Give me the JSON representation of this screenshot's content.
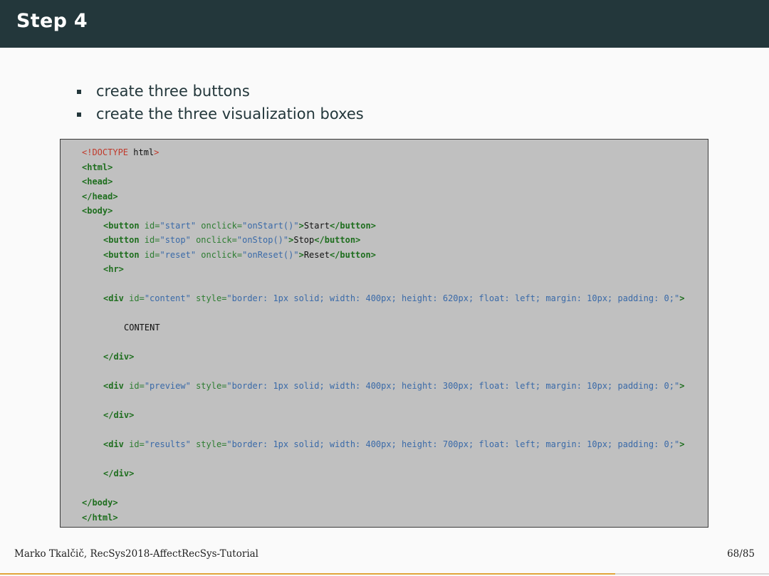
{
  "slide": {
    "title": "Step 4",
    "bullets": [
      "create three buttons",
      "create the three visualization boxes"
    ]
  },
  "code": {
    "doctype_open": "<!DOCTYPE",
    "doctype_html": " html",
    "doctype_close": ">",
    "html_open": "<html>",
    "head_open": "<head>",
    "head_close": "</head>",
    "body_open": "<body>",
    "button_tag": "<button",
    "button_close": "</button>",
    "id_attr": " id=",
    "onclick_attr": " onclick=",
    "style_attr": " style=",
    "gt": ">",
    "start_id": "\"start\"",
    "start_onclick": "\"onStart()\"",
    "start_text": "Start",
    "stop_id": "\"stop\"",
    "stop_onclick": "\"onStop()\"",
    "stop_text": "Stop",
    "reset_id": "\"reset\"",
    "reset_onclick": "\"onReset()\"",
    "reset_text": "Reset",
    "hr": "<hr>",
    "div_tag": "<div",
    "div_close": "</div>",
    "content_id": "\"content\"",
    "content_style": "\"border: 1px solid; width: 400px; height: 620px; float: left; margin: 10px; padding: 0;\"",
    "content_text": "CONTENT",
    "preview_id": "\"preview\"",
    "preview_style": "\"border: 1px solid; width: 400px; height: 300px; float: left; margin: 10px; padding: 0;\"",
    "results_id": "\"results\"",
    "results_style": "\"border: 1px solid; width: 400px; height: 700px; float: left; margin: 10px; padding: 0;\"",
    "body_close": "</body>",
    "html_close": "</html>"
  },
  "footer": {
    "author": "Marko Tkalčič, RecSys2018-AffectRecSys-Tutorial",
    "page": "68/85"
  },
  "progress": {
    "fraction": 0.8
  },
  "colors": {
    "title_bar": "#23373b",
    "progress_bar": "#e2a53a"
  }
}
